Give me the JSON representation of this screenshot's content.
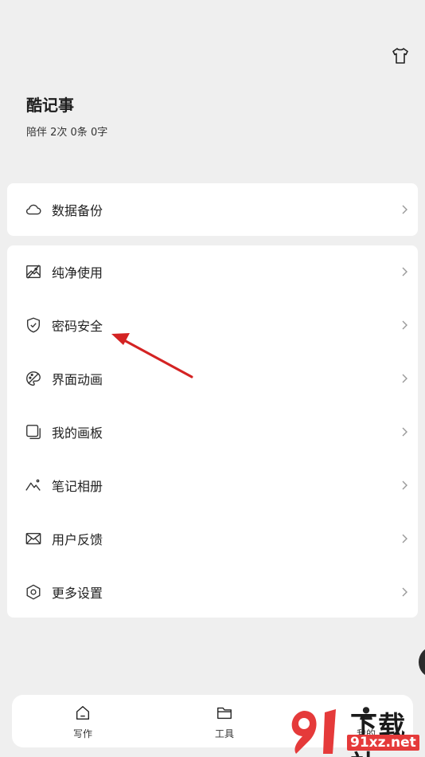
{
  "header": {
    "title": "酷记事",
    "stats": "陪伴 2次 0条 0字",
    "theme_icon": "tshirt-icon"
  },
  "backup": {
    "label": "数据备份",
    "icon": "cloud-icon"
  },
  "menu": {
    "items": [
      {
        "label": "纯净使用",
        "icon": "no-image-icon"
      },
      {
        "label": "密码安全",
        "icon": "shield-check-icon"
      },
      {
        "label": "界面动画",
        "icon": "palette-icon"
      },
      {
        "label": "我的画板",
        "icon": "board-icon"
      },
      {
        "label": "笔记相册",
        "icon": "mountain-icon"
      },
      {
        "label": "用户反馈",
        "icon": "mail-icon"
      },
      {
        "label": "更多设置",
        "icon": "hexagon-icon"
      }
    ]
  },
  "tabs": [
    {
      "label": "写作",
      "icon": "home-icon"
    },
    {
      "label": "工具",
      "icon": "folder-icon"
    },
    {
      "label": "我的",
      "icon": "person-icon"
    }
  ],
  "annotation": {
    "color": "#d42323",
    "target": "密码安全"
  },
  "watermark": {
    "big": "下载站",
    "small": "91xz.net",
    "color": "#e53a3a"
  }
}
